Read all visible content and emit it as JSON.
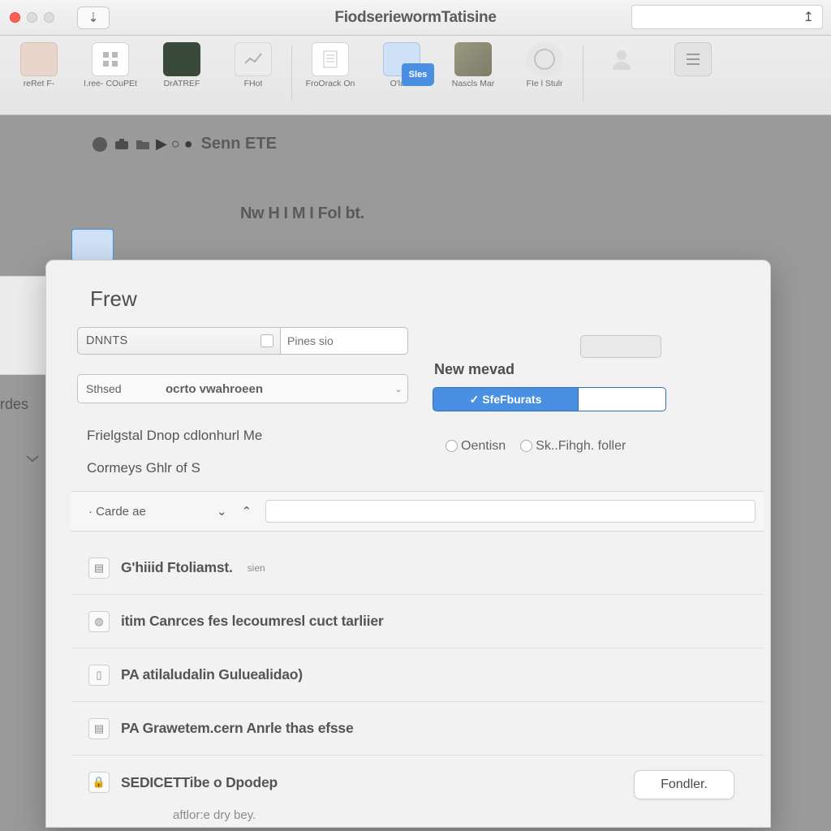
{
  "titlebar": {
    "title": "FiodseriewormTatisine",
    "upload_icon": "↥"
  },
  "toolbar": {
    "items": [
      {
        "label": "reRet F-",
        "tint": "#e8d6cd"
      },
      {
        "label": "I.ree- COuPEt",
        "tint": "#ffffff"
      },
      {
        "label": "DrATREF",
        "tint": "#3a4a3a"
      },
      {
        "label": "FHot",
        "tint": "#ececec"
      },
      {
        "label": "FroOrack On",
        "tint": "#ffffff"
      },
      {
        "label": "O'lalkt",
        "tint": "#86a8d8",
        "badge": "Sles"
      },
      {
        "label": "Nascls Mar",
        "tint": "#8d8d78"
      },
      {
        "label": "FIe l Stulr",
        "tint": "#dcdcdc"
      }
    ]
  },
  "backdrop": {
    "header_trail": "Senn ETE",
    "sub": "Nw H I M I Fol bt."
  },
  "left_cut": {
    "label": "rdes"
  },
  "dialog": {
    "title": "Frew",
    "row1": {
      "left": "DNNTS",
      "right": "Pines sio"
    },
    "row2": {
      "a": "Sthsed",
      "b": "ocrto vwahroeen"
    },
    "line1": "Frielgstal Dnop cdlonhurl Me",
    "line2": "Cormeys Ghlr of S",
    "exp_label": "· Carde ae",
    "right": {
      "label": "New mevad",
      "selected": "✓  SfeFburats",
      "radio1": "Oentisn",
      "radio2": "Sk..Fihgh. foller"
    },
    "items": [
      {
        "text": "G'hiiid Ftoliamst.",
        "small": "sien"
      },
      {
        "text": "itim Canrces fes lecoumresl cuct tarliier"
      },
      {
        "text": "PA atilaludalin  Guluealidao)"
      },
      {
        "text": "PA Grawetem.cern  Anrle thas efsse"
      },
      {
        "text": "SEDICETTibe o Dpodep"
      }
    ],
    "footer": "Fondler.",
    "below": "aftlor:e dry bey."
  }
}
